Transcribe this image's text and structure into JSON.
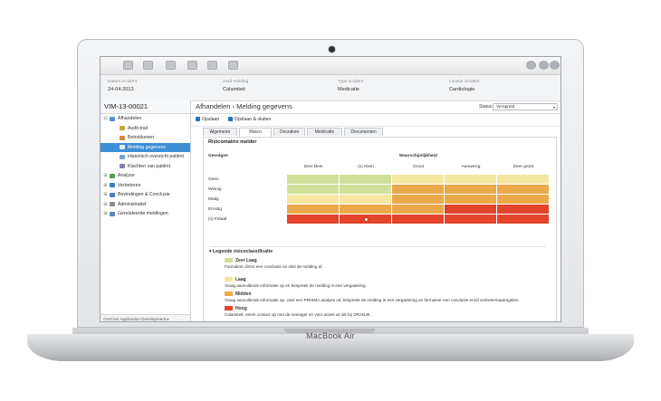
{
  "laptop": {
    "brand": "MacBook Air"
  },
  "toolbar": {
    "icons": [
      "app-menu-icon",
      "new-doc-icon",
      "doc-icon",
      "doc-copy-icon",
      "checklist-icon",
      "print-icon",
      "export-icon",
      "help-icon",
      "user-icon",
      "settings-icon"
    ]
  },
  "incident": {
    "fields": [
      {
        "label": "Datum incident",
        "value": "24-04-2013"
      },
      {
        "label": "Aard melding",
        "value": "Calamiteit"
      },
      {
        "label": "Type incident",
        "value": "Medicatie"
      },
      {
        "label": "Locatie incident",
        "value": "Cardiologie"
      }
    ]
  },
  "sidebar": {
    "title": "VIM-13-00021",
    "items": [
      {
        "label": "Afhandelen",
        "level": 0,
        "toggle": "⊟",
        "color": "#5a8fd0"
      },
      {
        "label": "Audit-trail",
        "level": 1,
        "toggle": "",
        "color": "#c9a646"
      },
      {
        "label": "Betrokkenen",
        "level": 1,
        "toggle": "",
        "color": "#d08a3a"
      },
      {
        "label": "Melding gegevens",
        "level": 1,
        "toggle": "",
        "color": "#e8e8e8",
        "selected": true
      },
      {
        "label": "Historisch overzicht patiënt",
        "level": 1,
        "toggle": "",
        "color": "#7aa0c8"
      },
      {
        "label": "Klachten van patiënt",
        "level": 1,
        "toggle": "",
        "color": "#7d7fa6"
      },
      {
        "label": "Analyse",
        "level": 0,
        "toggle": "⊞",
        "color": "#5b9b4a"
      },
      {
        "label": "Verbeteren",
        "level": 0,
        "toggle": "⊞",
        "color": "#3f7fc4"
      },
      {
        "label": "Bevindingen & Conclusie",
        "level": 0,
        "toggle": "⊞",
        "color": "#4d7db8"
      },
      {
        "label": "Administratief",
        "level": 0,
        "toggle": "⊞",
        "color": "#8a8f96"
      },
      {
        "label": "Gerelateerde meldingen",
        "level": 0,
        "toggle": "⊞",
        "color": "#5e84b8"
      }
    ],
    "footer": "GreCom Application Development ▸"
  },
  "main": {
    "breadcrumb": "Afhandelen › Melding gegevens",
    "status_label": "Status",
    "status_value": "Verspreid",
    "actions": [
      "Opslaan",
      "Opslaan & sluiten"
    ],
    "tabs": [
      {
        "label": "Algemeen",
        "active": false
      },
      {
        "label": "Risico",
        "active": true
      },
      {
        "label": "Oorzaken",
        "active": false
      },
      {
        "label": "Medicatie",
        "active": false
      },
      {
        "label": "Documenten",
        "active": false
      }
    ]
  },
  "risk_matrix": {
    "title": "Risicomatrix melder",
    "row_header": "Gevolgen",
    "col_header": "Waarschijnlijkheid",
    "columns": [
      "Zeer klein",
      "(x) Klein",
      "Groot",
      "Aanwezig",
      "Zeer groot"
    ],
    "rows": [
      "Geen",
      "Weinig",
      "Matig",
      "Ernstig",
      "(x) Fataal"
    ],
    "colors": {
      "zeer_laag": "#cfe09a",
      "laag": "#f5e7a1",
      "midden": "#eaa94a",
      "hoog": "#e2452c"
    },
    "cells": [
      [
        "zeer_laag",
        "zeer_laag",
        "laag",
        "laag",
        "laag"
      ],
      [
        "zeer_laag",
        "zeer_laag",
        "midden",
        "midden",
        "midden"
      ],
      [
        "laag",
        "laag",
        "midden",
        "midden",
        "midden"
      ],
      [
        "midden",
        "midden",
        "midden",
        "hoog",
        "hoog"
      ],
      [
        "hoog",
        "hoog",
        "hoog",
        "hoog",
        "hoog"
      ]
    ],
    "selected": {
      "row": 4,
      "col": 1
    }
  },
  "legend": {
    "title": "Legende risicoclassificatie",
    "items": [
      {
        "name": "Zeer Laag",
        "key": "zeer_laag",
        "desc": "Formuleer direct een conclusie en sluit de melding af."
      },
      {
        "name": "Laag",
        "key": "laag",
        "desc": "Vraag aanvullende informatie op en bespreek de melding in een vergadering."
      },
      {
        "name": "Midden",
        "key": "midden",
        "desc": "Vraag aanvullende informatie op, voer een PRISMA analyse uit, bespreek de melding in een vergadering en formuleer een conclusie en/of verbetermaatregelen."
      },
      {
        "name": "Hoog",
        "key": "hoog",
        "desc": "Calamiteit: neem contact op met de manager en voer acties uit als bij ORANJE."
      }
    ]
  }
}
